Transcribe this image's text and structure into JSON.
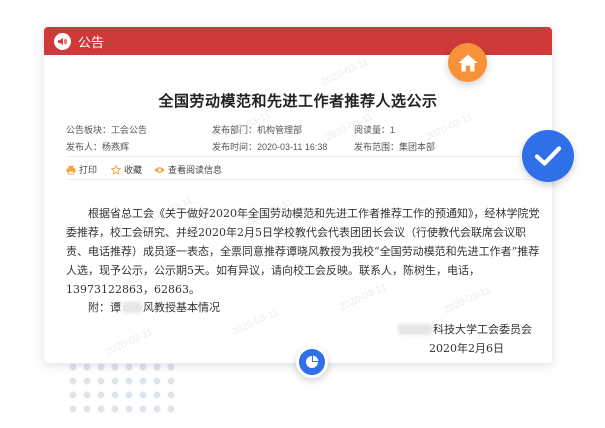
{
  "colors": {
    "header_bg": "#d0393a",
    "accent_orange": "#f7913a",
    "accent_blue": "#2f6fe8",
    "action_icon": "#f0a43a",
    "dots": "#dfe3ec"
  },
  "header": {
    "title": "公告",
    "icon": "speaker-icon"
  },
  "article": {
    "title": "全国劳动模范和先进工作者推荐人选公示",
    "meta": {
      "section": "公告板块：工会公告",
      "department": "发布部门：机构管理部",
      "views": "阅读量：1",
      "author": "发布人：杨燕辉",
      "time": "发布时间：2020-03-11 16:38",
      "scope": "发布范围：集团本部"
    },
    "actions": {
      "print": "打印",
      "favorite": "收藏",
      "view_info": "查看阅读信息"
    },
    "body": "根据省总工会《关于做好2020年全国劳动模范和先进工作者推荐工作的预通知》，经林学院党委推荐，校工会研究、并经2020年2月5日学校教代会代表团团长会议（行使教代会联席会议职责、电话推荐）成员逐一表态，全票同意推荐谭晓风教授为我校“全国劳动模范和先进工作者”推荐人选，现予公示，公示期5天。如有异议，请向校工会反映。联系人，陈树生，电话，13973122863，62863。",
    "attachment_prefix": "附：谭",
    "attachment_suffix": "风教授基本情况",
    "signature_suffix": "科技大学工会委员会",
    "date": "2020年2月6日"
  },
  "watermark": "2020-03-11"
}
